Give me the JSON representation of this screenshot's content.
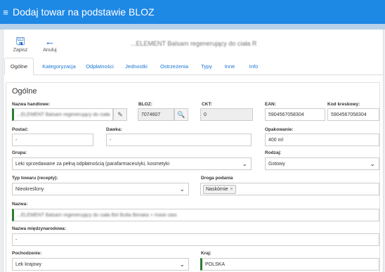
{
  "header": {
    "title": "Dodaj towar na podstawie BLOZ",
    "menu_icon": "hamburger-icon"
  },
  "toolbar": {
    "save_label": "Zapisz",
    "save_icon": "floppy-disk-icon",
    "cancel_label": "Anuluj",
    "cancel_icon": "arrow-left-icon"
  },
  "product_title": "...ELEMENT Balsam regenerujący do ciała R",
  "tabs": [
    "Ogólne",
    "Kategoryzacja",
    "Odpłatności",
    "Jednostki",
    "Ostrzeżenia",
    "Typy",
    "Inne",
    "Info"
  ],
  "section": {
    "title": "Ogólne",
    "trade_name": {
      "label": "Nazwa handlowe:",
      "value": "...ELEMENT Balsam regenerujący do ciała"
    },
    "bloz": {
      "label": "BLOZ:",
      "value": "7074607"
    },
    "ckt": {
      "label": "CKT:",
      "value": "0"
    },
    "ean": {
      "label": "EAN:",
      "value": "5904567058304"
    },
    "barcode": {
      "label": "Kod kreskowy:",
      "value": "5904567058304"
    },
    "form": {
      "label": "Postać:",
      "value": "-"
    },
    "dose": {
      "label": "Dawka:",
      "value": "-"
    },
    "package": {
      "label": "Opakowanie:",
      "value": "400 ml"
    },
    "group": {
      "label": "Grupa:",
      "value": "Leki sprzedawane za pełną odpłatnością (parafarmaceutyki, kosmetyki"
    },
    "kind": {
      "label": "Rodzaj:",
      "value": "Gotowy"
    },
    "product_type": {
      "label": "Typ towaru (recepty):",
      "value": "Nieokreślony"
    },
    "route": {
      "label": "Droga podania",
      "tag": "Naskórnie",
      "tag_remove": "×"
    },
    "name": {
      "label": "Nazwa:",
      "value": "...ELEMENT Balsam regenerujący do ciała Ból Butla Bimaka + mask utas"
    },
    "intl_name": {
      "label": "Nazwa międzynarodowa:",
      "value": "-"
    },
    "origin": {
      "label": "Pochodzenie:",
      "value": "Lek krajowy"
    },
    "country": {
      "label": "Kraj:",
      "value": "POLSKA"
    }
  },
  "icons": {
    "edit": "pencil-icon",
    "search": "search-icon",
    "dropdown": "chevron-down-icon"
  }
}
